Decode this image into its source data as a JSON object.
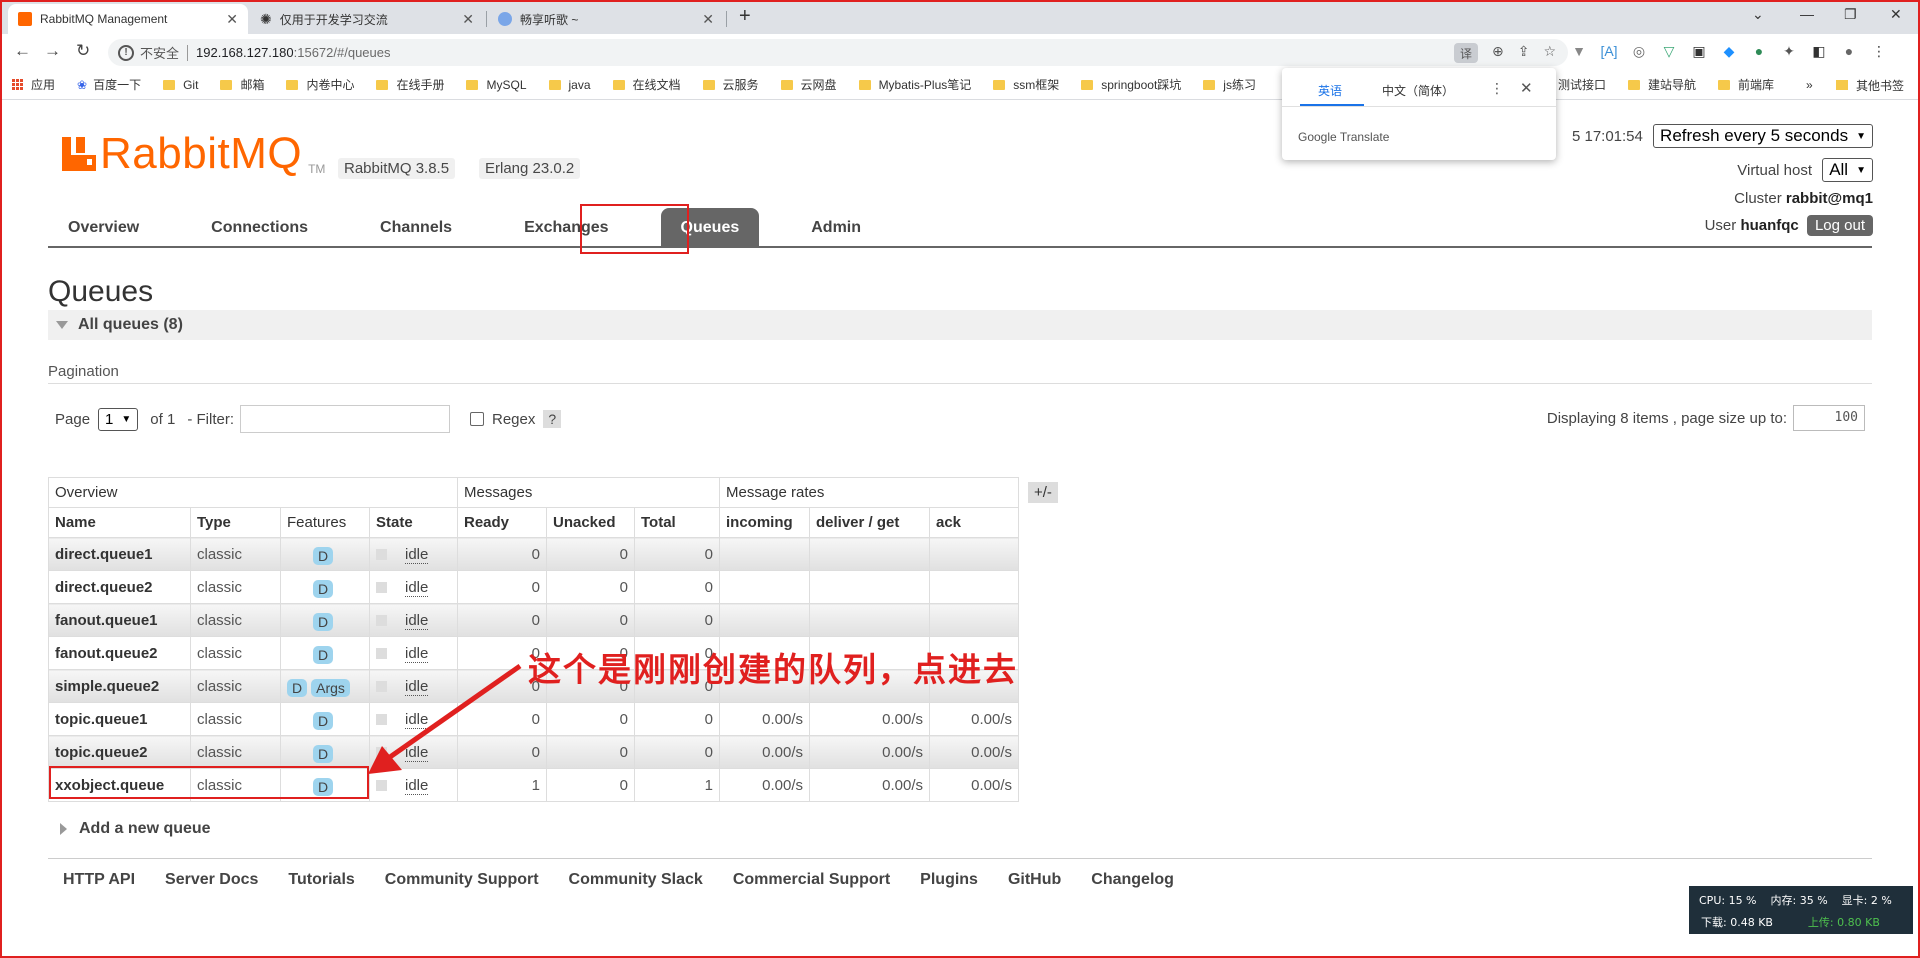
{
  "browser": {
    "tabs": [
      {
        "title": "RabbitMQ Management",
        "active": true
      },
      {
        "title": "仅用于开发学习交流",
        "active": false
      },
      {
        "title": "畅享听歌 ~",
        "active": false
      }
    ],
    "address": {
      "insecure_label": "不安全",
      "host": "192.168.127.180",
      "path": ":15672/#/queues"
    },
    "bookmarks": [
      "应用",
      "百度一下",
      "Git",
      "邮箱",
      "内卷中心",
      "在线手册",
      "MySQL",
      "java",
      "在线文档",
      "云服务",
      "云网盘",
      "Mybatis-Plus笔记",
      "ssm框架",
      "springboot踩坑",
      "js练习",
      "测试接口",
      "建站导航",
      "前端库"
    ],
    "bookmarks_more": "»",
    "bookmarks_other": "其他书签"
  },
  "translate_popup": {
    "lang_source": "英语",
    "lang_target": "中文（简体）",
    "brand": "Google",
    "product": "Translate"
  },
  "header": {
    "logo_text": "RabbitMQ",
    "logo_tm": "TM",
    "rabbit_version": "RabbitMQ 3.8.5",
    "erlang_version": "Erlang 23.0.2",
    "refreshed_time": "5 17:01:54",
    "refresh_select": "Refresh every 5 seconds",
    "vhost_label": "Virtual host",
    "vhost_value": "All",
    "cluster_label": "Cluster",
    "cluster_value": "rabbit@mq1",
    "user_label": "User",
    "user_value": "huanfqc",
    "logout_label": "Log out"
  },
  "nav": [
    "Overview",
    "Connections",
    "Channels",
    "Exchanges",
    "Queues",
    "Admin"
  ],
  "page": {
    "title": "Queues",
    "section": "All queues (8)",
    "pagination_title": "Pagination",
    "page_label": "Page",
    "page_value": "1",
    "of_label": "of 1",
    "filter_label": "- Filter:",
    "regex_label": "Regex",
    "help_label": "?",
    "displaying": "Displaying 8 items , page size up to:",
    "page_size": "100",
    "plusminus": "+/-",
    "add_queue": "Add a new queue"
  },
  "table": {
    "groups": [
      "Overview",
      "Messages",
      "Message rates"
    ],
    "columns": [
      "Name",
      "Type",
      "Features",
      "State",
      "Ready",
      "Unacked",
      "Total",
      "incoming",
      "deliver / get",
      "ack"
    ],
    "rows": [
      {
        "name": "direct.queue1",
        "type": "classic",
        "features": [
          "D"
        ],
        "state": "idle",
        "ready": "0",
        "unacked": "0",
        "total": "0",
        "incoming": "",
        "deliver": "",
        "ack": ""
      },
      {
        "name": "direct.queue2",
        "type": "classic",
        "features": [
          "D"
        ],
        "state": "idle",
        "ready": "0",
        "unacked": "0",
        "total": "0",
        "incoming": "",
        "deliver": "",
        "ack": ""
      },
      {
        "name": "fanout.queue1",
        "type": "classic",
        "features": [
          "D"
        ],
        "state": "idle",
        "ready": "0",
        "unacked": "0",
        "total": "0",
        "incoming": "",
        "deliver": "",
        "ack": ""
      },
      {
        "name": "fanout.queue2",
        "type": "classic",
        "features": [
          "D"
        ],
        "state": "idle",
        "ready": "0",
        "unacked": "0",
        "total": "0",
        "incoming": "",
        "deliver": "",
        "ack": ""
      },
      {
        "name": "simple.queue2",
        "type": "classic",
        "features": [
          "D",
          "Args"
        ],
        "state": "idle",
        "ready": "0",
        "unacked": "0",
        "total": "0",
        "incoming": "",
        "deliver": "",
        "ack": ""
      },
      {
        "name": "topic.queue1",
        "type": "classic",
        "features": [
          "D"
        ],
        "state": "idle",
        "ready": "0",
        "unacked": "0",
        "total": "0",
        "incoming": "0.00/s",
        "deliver": "0.00/s",
        "ack": "0.00/s"
      },
      {
        "name": "topic.queue2",
        "type": "classic",
        "features": [
          "D"
        ],
        "state": "idle",
        "ready": "0",
        "unacked": "0",
        "total": "0",
        "incoming": "0.00/s",
        "deliver": "0.00/s",
        "ack": "0.00/s"
      },
      {
        "name": "xxobject.queue",
        "type": "classic",
        "features": [
          "D"
        ],
        "state": "idle",
        "ready": "1",
        "unacked": "0",
        "total": "1",
        "incoming": "0.00/s",
        "deliver": "0.00/s",
        "ack": "0.00/s"
      }
    ]
  },
  "annotation": "这个是刚刚创建的队列，点进去",
  "footer": [
    "HTTP API",
    "Server Docs",
    "Tutorials",
    "Community Support",
    "Community Slack",
    "Commercial Support",
    "Plugins",
    "GitHub",
    "Changelog"
  ],
  "sysmon": {
    "cpu": "CPU: 15 %",
    "mem": "内存: 35 %",
    "gpu": "显卡: 2 %",
    "down": "下载: 0.48 KB",
    "up": "上传: 0.80 KB"
  },
  "colors": {
    "accent": "#ff6600",
    "annotation": "#e0201f",
    "badge": "#9ed4ee",
    "nav_active": "#666666"
  }
}
